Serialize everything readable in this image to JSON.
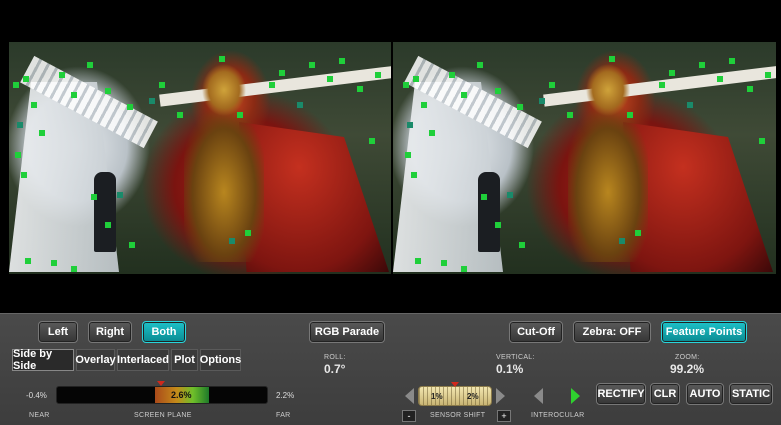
{
  "viewer": {
    "left_pane": "left-eye",
    "right_pane": "right-eye",
    "feature_point_color": "#1fcf3a"
  },
  "view_buttons": {
    "left": "Left",
    "right": "Right",
    "both": "Both"
  },
  "rgb_parade": "RGB Parade",
  "cut_off": "Cut-Off",
  "zebra": "Zebra: OFF",
  "feature_points": "Feature Points",
  "mode_tabs": [
    "Side by Side",
    "Overlay",
    "Interlaced",
    "Plot",
    "Options"
  ],
  "roll": {
    "label": "ROLL:",
    "value": "0.7°"
  },
  "vertical": {
    "label": "VERTICAL:",
    "value": "0.1%"
  },
  "zoom": {
    "label": "ZOOM:",
    "value": "99.2%"
  },
  "depth": {
    "near_value": "-0.4%",
    "far_value": "2.2%",
    "current": "2.6%",
    "near_label": "NEAR",
    "plane_label": "SCREEN PLANE",
    "far_label": "FAR"
  },
  "sensor_shift": {
    "left_val": "1%",
    "right_val": "2%",
    "label": "SENSOR SHIFT",
    "minus": "-",
    "plus": "+"
  },
  "interocular": {
    "label": "INTEROCULAR"
  },
  "actions": {
    "rectify": "RECTIFY",
    "clr": "CLR",
    "auto": "AUTO",
    "static": "STATIC"
  },
  "colors": {
    "accent": "#14aeb5",
    "marker": "#d0281c",
    "green_arrow": "#2fd12f"
  }
}
